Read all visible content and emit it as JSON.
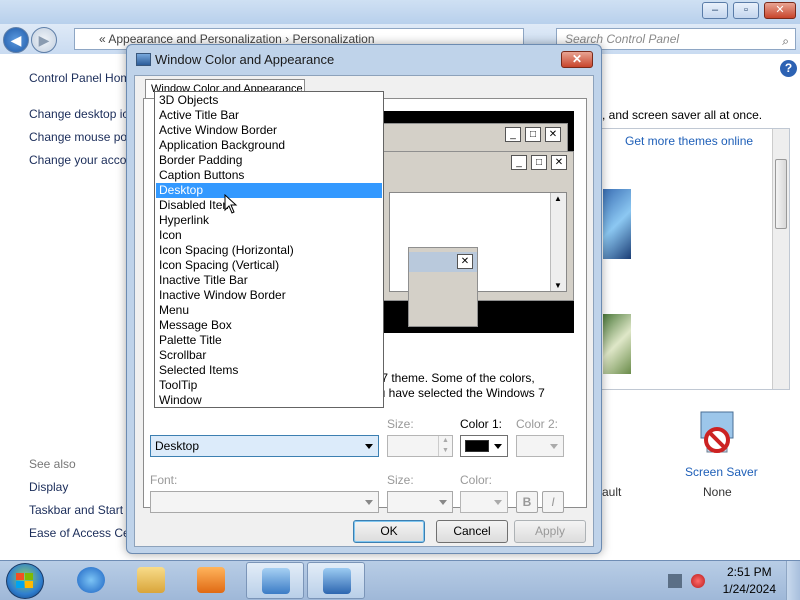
{
  "explorer": {
    "address": "«  Appearance and Personalization  ›  Personalization",
    "search_placeholder": "Search Control Panel",
    "window_buttons": [
      "–",
      "▫",
      "✕"
    ],
    "left_links": [
      "Control Panel Home",
      "Change desktop icons",
      "Change mouse pointers",
      "Change your account picture"
    ],
    "see_also_label": "See also",
    "see_also_links": [
      "Display",
      "Taskbar and Start Menu",
      "Ease of Access Center"
    ],
    "intro_text": ", and screen saver all at once.",
    "themes_link": "Get more themes online",
    "fault_text": "ault",
    "screen_saver_label": "Screen Saver",
    "screen_saver_value": "None"
  },
  "dialog": {
    "title": "Window Color and Appearance",
    "close_glyph": "✕",
    "tab_label": "Window Color and Appearance",
    "info_line1": "s 7 theme.  Some of the colors,",
    "info_line2": "ou have selected the Windows 7",
    "labels": {
      "size": "Size:",
      "color1": "Color 1:",
      "color2": "Color 2:",
      "font": "Font:",
      "font_size": "Size:",
      "font_color": "Color:"
    },
    "item_selected": "Desktop",
    "bold_label": "B",
    "italic_label": "I",
    "buttons": {
      "ok": "OK",
      "cancel": "Cancel",
      "apply": "Apply"
    },
    "preview_glyphs": {
      "minimize": "_",
      "maximize": "□",
      "close": "✕",
      "scroll_up": "▲",
      "scroll_down": "▼"
    }
  },
  "dropdown": {
    "items": [
      "3D Objects",
      "Active Title Bar",
      "Active Window Border",
      "Application Background",
      "Border Padding",
      "Caption Buttons",
      "Desktop",
      "Disabled Item",
      "Hyperlink",
      "Icon",
      "Icon Spacing (Horizontal)",
      "Icon Spacing (Vertical)",
      "Inactive Title Bar",
      "Inactive Window Border",
      "Menu",
      "Message Box",
      "Palette Title",
      "Scrollbar",
      "Selected Items",
      "ToolTip",
      "Window"
    ],
    "selected_item": "Desktop",
    "highlight_color": "#3399ff"
  },
  "taskbar": {
    "time": "2:51 PM",
    "date": "1/24/2024"
  },
  "colors": {
    "link": "#1e5fb8",
    "dialog_frame": "#bfd3ea",
    "preview_background": "#000000",
    "color1_swatch": "#000000"
  }
}
